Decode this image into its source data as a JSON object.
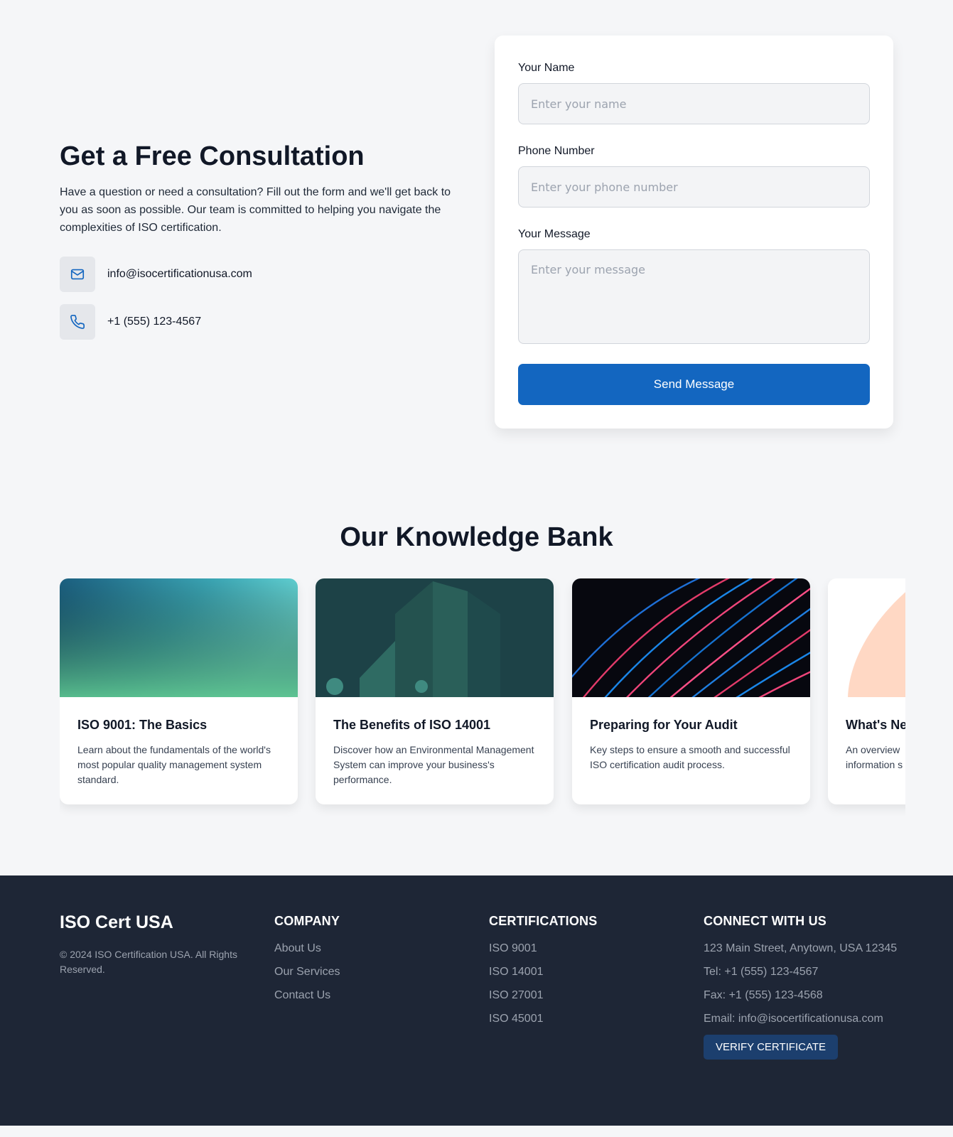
{
  "consultation": {
    "title": "Get a Free Consultation",
    "description": "Have a question or need a consultation? Fill out the form and we'll get back to you as soon as possible. Our team is committed to helping you navigate the complexities of ISO certification.",
    "email": "info@isocertificationusa.com",
    "phone": "+1 (555) 123-4567",
    "icons": [
      "mail-icon",
      "phone-icon"
    ]
  },
  "form": {
    "name_label": "Your Name",
    "name_placeholder": "Enter your name",
    "phone_label": "Phone Number",
    "phone_placeholder": "Enter your phone number",
    "message_label": "Your Message",
    "message_placeholder": "Enter your message",
    "submit_label": "Send Message"
  },
  "knowledge_bank": {
    "title": "Our Knowledge Bank",
    "cards": [
      {
        "title": "ISO 9001: The Basics",
        "description": "Learn about the fundamentals of the world's most popular quality management system standard."
      },
      {
        "title": "The Benefits of ISO 14001",
        "description": "Discover how an Environmental Management System can improve your business's performance."
      },
      {
        "title": "Preparing for Your Audit",
        "description": "Key steps to ensure a smooth and successful ISO certification audit process."
      },
      {
        "title": "What's Ne",
        "description": "An overview information s"
      }
    ]
  },
  "footer": {
    "brand": "ISO Cert USA",
    "copyright": "© 2024 ISO Certification USA. All Rights Reserved.",
    "company": {
      "heading": "COMPANY",
      "links": [
        "About Us",
        "Our Services",
        "Contact Us"
      ]
    },
    "certifications": {
      "heading": "CERTIFICATIONS",
      "links": [
        "ISO 9001",
        "ISO 14001",
        "ISO 27001",
        "ISO 45001"
      ]
    },
    "connect": {
      "heading": "CONNECT WITH US",
      "address": "123 Main Street, Anytown, USA 12345",
      "tel": "Tel: +1 (555) 123-4567",
      "fax": "Fax: +1 (555) 123-4568",
      "email": "Email: info@isocertificationusa.com",
      "verify_label": "VERIFY CERTIFICATE"
    }
  },
  "colors": {
    "primary": "#1366c0",
    "footer_bg": "#1e2636",
    "verify_bg": "#1c3f6e",
    "page_bg": "#f5f6f8"
  }
}
